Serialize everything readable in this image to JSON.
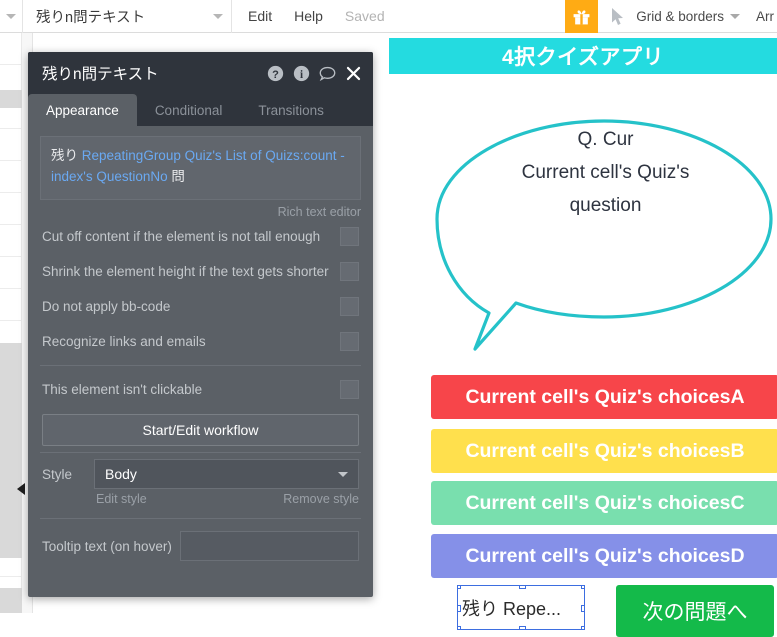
{
  "topbar": {
    "element_name": "残りn問テキスト",
    "menu": [
      {
        "label": "Edit",
        "muted": false
      },
      {
        "label": "Help",
        "muted": false
      },
      {
        "label": "Saved",
        "muted": true
      }
    ],
    "gift_icon": "gift-icon",
    "cursor_icon": "cursor-arrow-icon",
    "grid_dropdown": "Grid & borders",
    "arrange": "Arr",
    "accent_orange": "#ffab14"
  },
  "panel": {
    "title": "残りn問テキスト",
    "icons": [
      "help-circle-icon",
      "info-circle-icon",
      "comment-bubble-icon",
      "close-icon"
    ],
    "tabs": [
      {
        "label": "Appearance",
        "active": true
      },
      {
        "label": "Conditional",
        "active": false
      },
      {
        "label": "Transitions",
        "active": false
      }
    ],
    "rich_text": {
      "prefix": "残り ",
      "dynamic": "RepeatingGroup Quiz's List of Quizs:count - index's QuestionNo",
      "suffix": " 問",
      "caption": "Rich text editor",
      "link_color": "#6aa9f2"
    },
    "checkboxes": [
      {
        "label": "Cut off content if the element is not tall enough",
        "checked": false
      },
      {
        "label": "Shrink the element height if the text gets shorter",
        "checked": false
      },
      {
        "label": "Do not apply bb-code",
        "checked": false
      },
      {
        "label": "Recognize links and emails",
        "checked": false
      }
    ],
    "clickable_row": {
      "label": "This element isn't clickable",
      "checked": false
    },
    "workflow_button": "Start/Edit workflow",
    "style": {
      "label": "Style",
      "value": "Body",
      "edit_link": "Edit style",
      "remove_link": "Remove style"
    },
    "tooltip": {
      "label": "Tooltip text (on hover)",
      "value": "",
      "placeholder": ""
    }
  },
  "canvas": {
    "app_header": {
      "title": "4択クイズアプリ",
      "bg": "#24dbe0"
    },
    "bubble": {
      "line1": "Q. Cur",
      "line2": "Current cell's Quiz's",
      "line3": "question",
      "stroke": "#25c2c9"
    },
    "choices": [
      {
        "label": "Current cell's Quiz's choicesA",
        "color": "#f7454a"
      },
      {
        "label": "Current cell's Quiz's choicesB",
        "color": "#ffe04d"
      },
      {
        "label": "Current cell's Quiz's choicesC",
        "color": "#79dfae"
      },
      {
        "label": "Current cell's Quiz's choicesD",
        "color": "#8590e8"
      }
    ],
    "selected_element": {
      "text": "残り Repe...",
      "selection_color": "#3d6ee0"
    },
    "next_button": {
      "label": "次の問題へ",
      "color": "#14ba4a"
    }
  }
}
